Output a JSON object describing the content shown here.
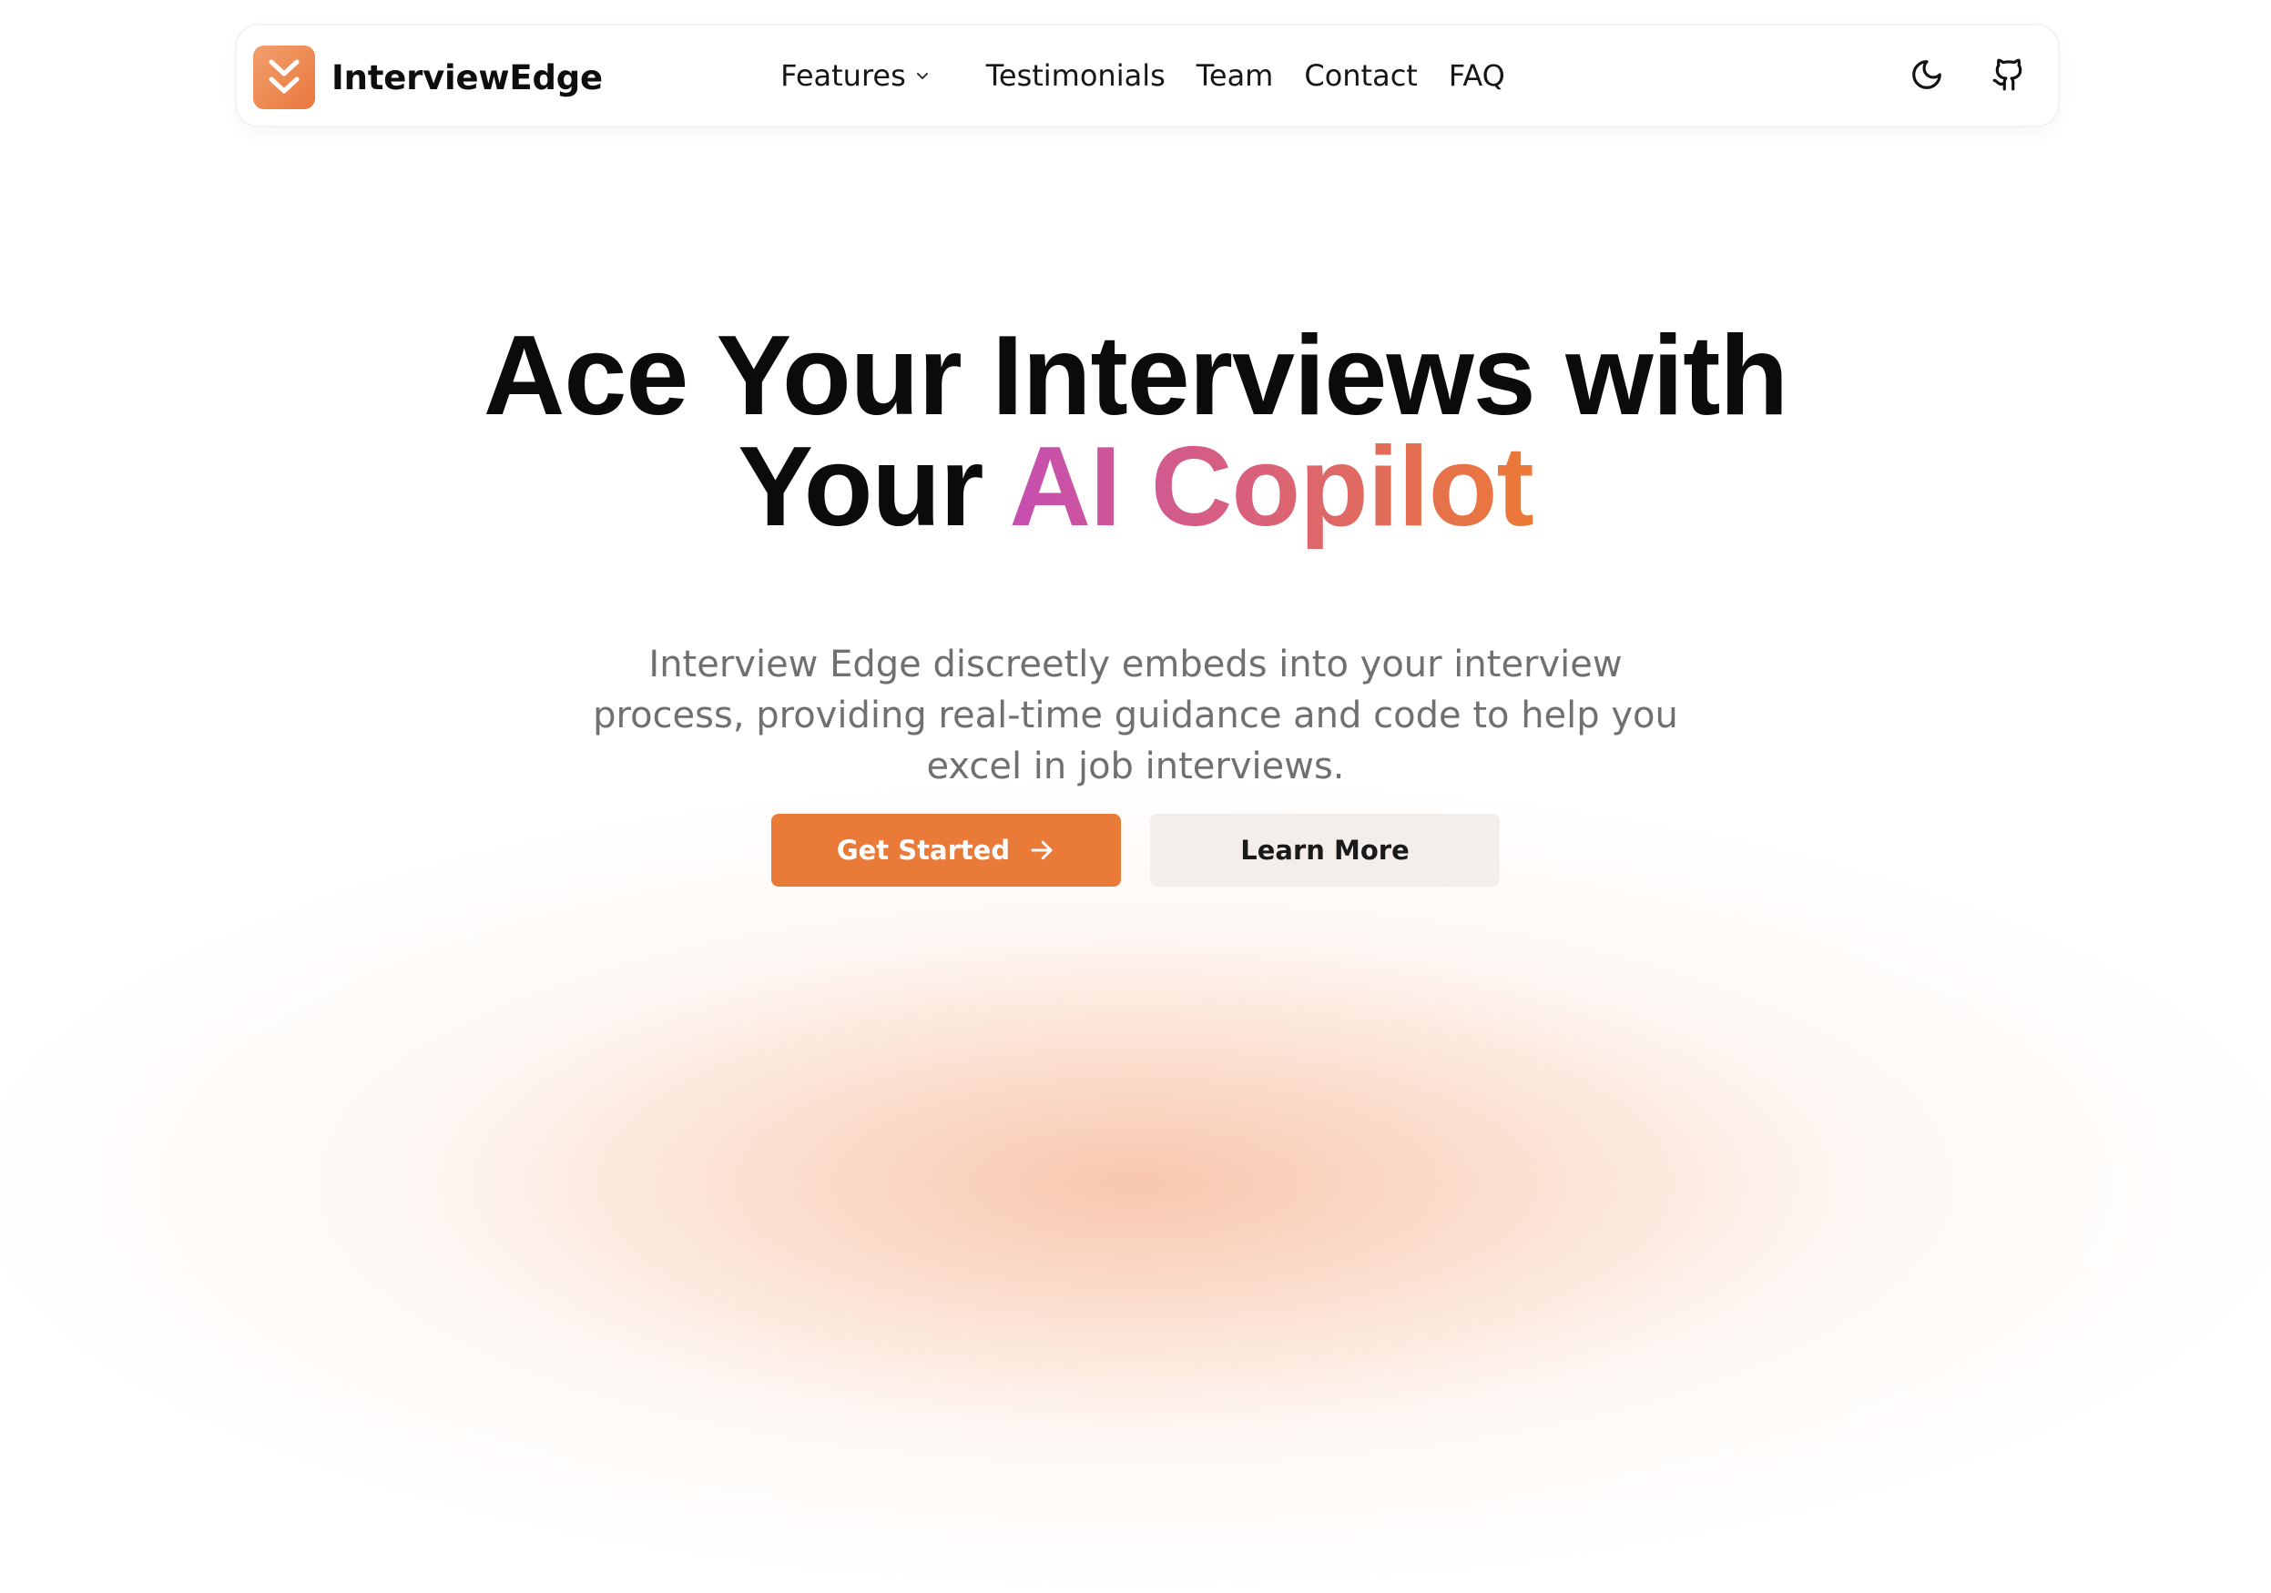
{
  "colors": {
    "accent": "#ea7a38",
    "gradient_start": "#c54eb1",
    "gradient_end": "#ec7a35",
    "subtitle": "#707070",
    "secondary_button_bg": "#f3eeea"
  },
  "nav": {
    "brand": {
      "logo_icon": "double-chevron-down-icon",
      "name": "InterviewEdge"
    },
    "menu": [
      {
        "label": "Features",
        "has_dropdown": true,
        "icon": "chevron-down-icon"
      },
      {
        "label": "Testimonials"
      },
      {
        "label": "Team"
      },
      {
        "label": "Contact"
      },
      {
        "label": "FAQ"
      }
    ],
    "icons": {
      "theme_toggle": "moon-icon",
      "repository": "github-icon"
    }
  },
  "hero": {
    "headline_line1": "Ace Your Interviews with",
    "headline_line2_prefix": "Your",
    "headline_highlight": "AI Copilot",
    "subtitle": "Interview Edge discreetly embeds into your interview process, providing real-time guidance and code to help you excel in job interviews.",
    "primary_button": {
      "label": "Get Started",
      "icon": "arrow-right-icon"
    },
    "secondary_button": {
      "label": "Learn More"
    }
  }
}
